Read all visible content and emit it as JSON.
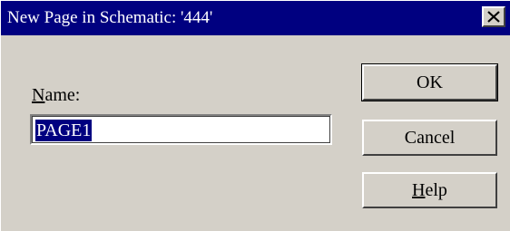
{
  "dialog": {
    "title": "New Page in Schematic:  '444'",
    "name_label_mnemonic": "N",
    "name_label_rest": "ame:",
    "name_value": "PAGE1"
  },
  "buttons": {
    "ok": "OK",
    "cancel": "Cancel",
    "help_mnemonic": "H",
    "help_rest": "elp"
  },
  "icons": {
    "close": "close-icon"
  },
  "colors": {
    "titlebar": "#000080",
    "face": "#d4d0c8",
    "selection": "#000080"
  }
}
